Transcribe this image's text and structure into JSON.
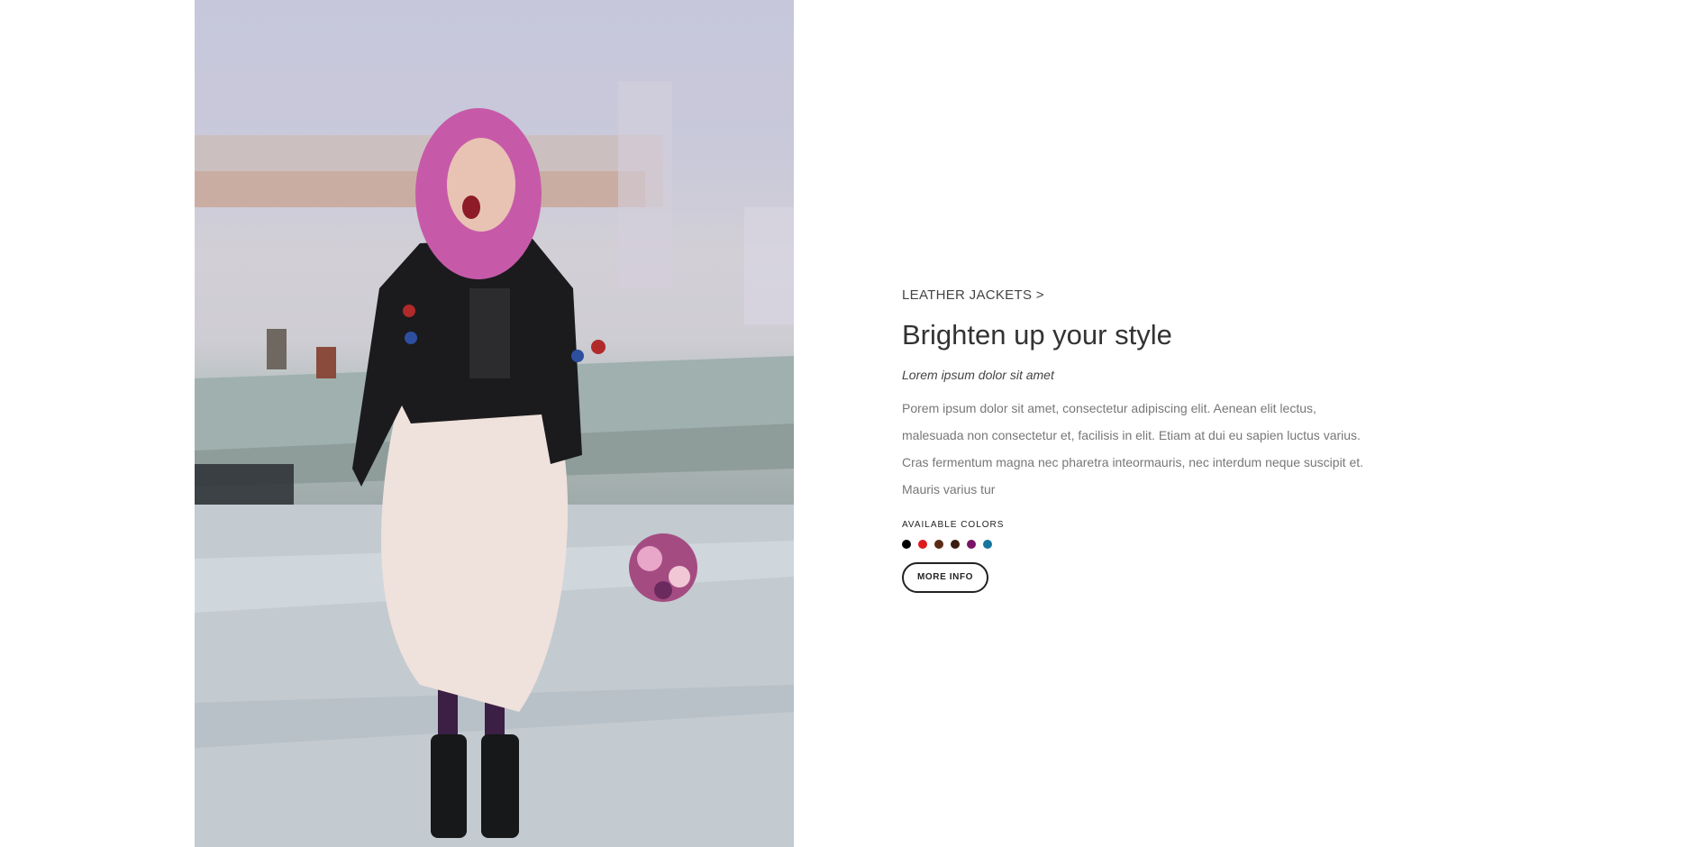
{
  "photo": {
    "alt_subject": "woman-in-leather-jacket"
  },
  "product": {
    "category_link": "LEATHER JACKETS >",
    "title": "Brighten up your style",
    "subtitle": "Lorem ipsum dolor sit amet",
    "description": "Porem ipsum dolor sit amet, consectetur adipiscing elit. Aenean elit lectus, malesuada non consectetur et, facilisis in elit. Etiam at dui eu sapien luctus varius. Cras fermentum magna nec pharetra inteormauris, nec interdum neque suscipit et. Mauris varius tur",
    "colors_label": "AVAILABLE COLORS",
    "colors": [
      "#000000",
      "#e0191c",
      "#5a2b14",
      "#3a1d10",
      "#7a1466",
      "#1477a0"
    ],
    "more_info_label": "MORE INFO"
  }
}
